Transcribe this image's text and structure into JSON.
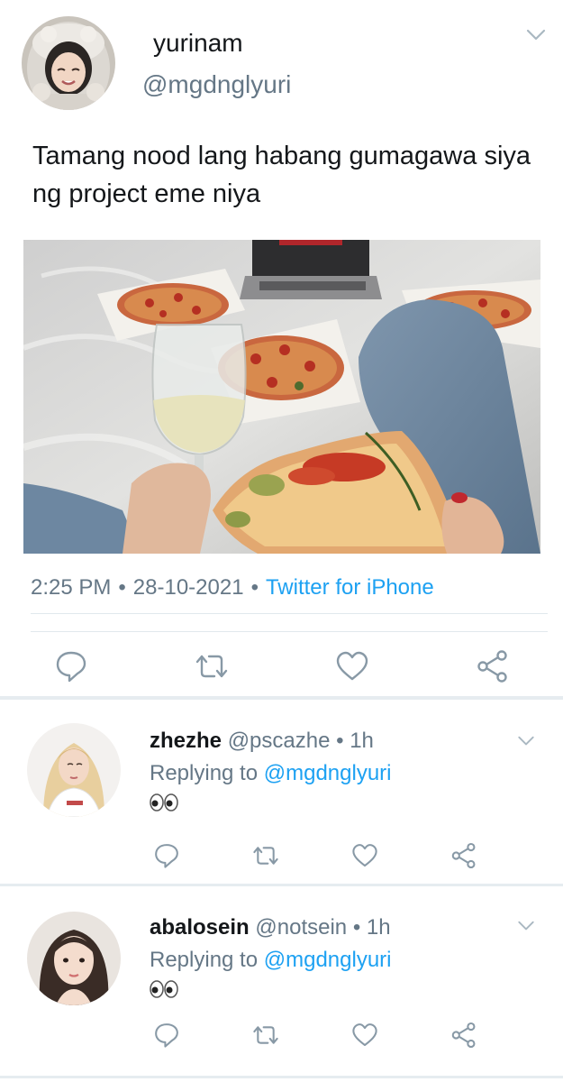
{
  "tweet": {
    "display_name": "yurinam",
    "handle": "@mgdnglyuri",
    "text": "Tamang nood lang habang gumagawa siya ng project eme niya",
    "time": "2:25 PM",
    "date": "28-10-2021",
    "source": "Twitter for iPhone",
    "separator": "•",
    "icons": {
      "avatar": "user-avatar-hooded",
      "menu": "chevron-down-icon",
      "reply": "speech-bubble-icon",
      "retweet": "retweet-arrows-icon",
      "like": "heart-icon",
      "share": "share-nodes-icon"
    }
  },
  "replies": [
    {
      "display_name": "zhezhe",
      "handle": "@pscazhe",
      "dot": "•",
      "time": "1h",
      "replying_prefix": "Replying to ",
      "replying_to": "@mgdnglyuri",
      "body_emoji": "eyes-emoji"
    },
    {
      "display_name": "abalosein",
      "handle": "@notsein",
      "dot": "•",
      "time": "1h",
      "replying_prefix": "Replying to ",
      "replying_to": "@mgdnglyuri",
      "body_emoji": "eyes-emoji"
    }
  ],
  "colors": {
    "text_primary": "#14171a",
    "text_secondary": "#657786",
    "link": "#1da1f2",
    "divider": "#e1e8ed",
    "icon": "#8899a6"
  }
}
